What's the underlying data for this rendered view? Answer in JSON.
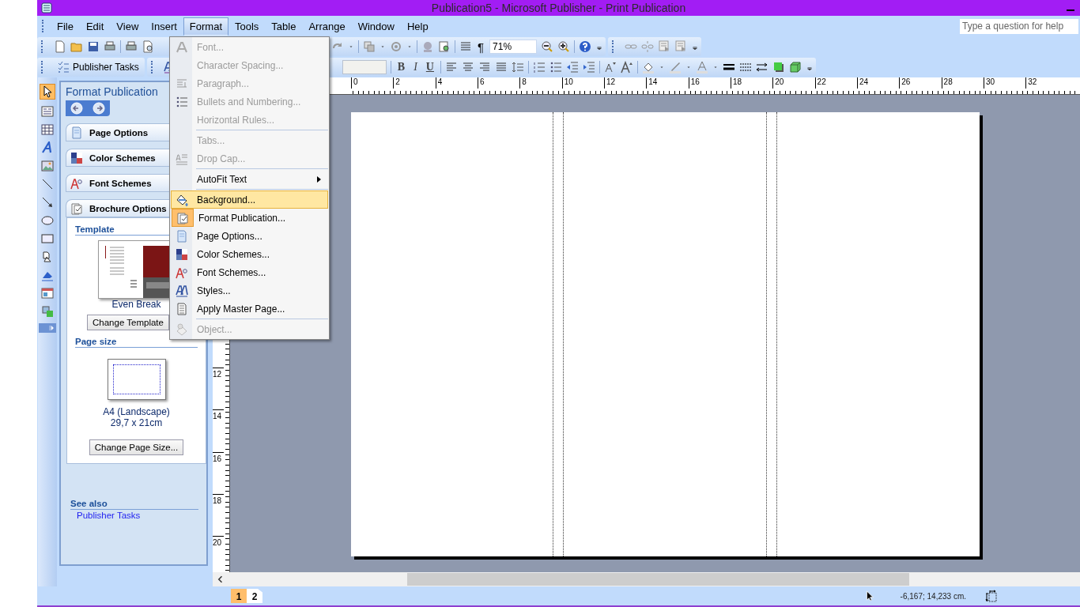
{
  "window": {
    "title": "Publication5 - Microsoft Publisher - Print Publication"
  },
  "menu_bar": {
    "items": [
      {
        "label": "File",
        "selected": false
      },
      {
        "label": "Edit",
        "selected": false
      },
      {
        "label": "View",
        "selected": false
      },
      {
        "label": "Insert",
        "selected": false
      },
      {
        "label": "Format",
        "selected": true
      },
      {
        "label": "Tools",
        "selected": false
      },
      {
        "label": "Table",
        "selected": false
      },
      {
        "label": "Arrange",
        "selected": false
      },
      {
        "label": "Window",
        "selected": false
      },
      {
        "label": "Help",
        "selected": false
      }
    ],
    "help_box": {
      "placeholder": "Type a question for help"
    }
  },
  "toolbar": {
    "tasks_button": "Publisher Tasks",
    "pilcrow": "¶",
    "zoom": "71%",
    "bold": "B",
    "italic": "I",
    "underline": "U"
  },
  "format_menu": {
    "items": [
      {
        "kind": "item",
        "label": "Font...",
        "disabled": true,
        "selected": false,
        "checked": false
      },
      {
        "kind": "item",
        "label": "Character Spacing...",
        "disabled": true,
        "selected": false,
        "checked": false
      },
      {
        "kind": "item",
        "label": "Paragraph...",
        "disabled": true,
        "selected": false,
        "checked": false
      },
      {
        "kind": "item",
        "label": "Bullets and Numbering...",
        "disabled": true,
        "selected": false,
        "checked": false
      },
      {
        "kind": "item",
        "label": "Horizontal Rules...",
        "disabled": true,
        "selected": false,
        "checked": false
      },
      {
        "kind": "separator"
      },
      {
        "kind": "item",
        "label": "Tabs...",
        "disabled": true,
        "selected": false,
        "checked": false
      },
      {
        "kind": "item",
        "label": "Drop Cap...",
        "disabled": true,
        "selected": false,
        "checked": false
      },
      {
        "kind": "separator"
      },
      {
        "kind": "submenu",
        "label": "AutoFit Text",
        "disabled": false,
        "selected": false,
        "checked": false
      },
      {
        "kind": "separator"
      },
      {
        "kind": "item",
        "label": "Background...",
        "disabled": false,
        "selected": true,
        "checked": false
      },
      {
        "kind": "item",
        "label": "Format Publication...",
        "disabled": false,
        "selected": false,
        "checked": true
      },
      {
        "kind": "item",
        "label": "Page Options...",
        "disabled": false,
        "selected": false,
        "checked": false
      },
      {
        "kind": "item",
        "label": "Color Schemes...",
        "disabled": false,
        "selected": false,
        "checked": false
      },
      {
        "kind": "item",
        "label": "Font Schemes...",
        "disabled": false,
        "selected": false,
        "checked": false
      },
      {
        "kind": "item",
        "label": "Styles...",
        "disabled": false,
        "selected": false,
        "checked": false
      },
      {
        "kind": "item",
        "label": "Apply Master Page...",
        "disabled": false,
        "selected": false,
        "checked": false
      },
      {
        "kind": "separator"
      },
      {
        "kind": "item",
        "label": "Object...",
        "disabled": true,
        "selected": false,
        "checked": false
      }
    ]
  },
  "task_pane": {
    "title": "Format Publication",
    "sections": [
      {
        "label": "Page Options"
      },
      {
        "label": "Color Schemes"
      },
      {
        "label": "Font Schemes"
      },
      {
        "label": "Brochure Options"
      }
    ],
    "template": {
      "heading": "Template",
      "name": "Even Break",
      "button": "Change Template"
    },
    "page_size": {
      "heading": "Page size",
      "name": "A4 (Landscape)",
      "dimensions": "29,7 x 21cm",
      "button": "Change Page Size..."
    },
    "see_also": {
      "heading": "See also",
      "links": [
        "Publisher Tasks"
      ]
    }
  },
  "rulers": {
    "horizontal": [
      "0",
      "2",
      "4",
      "6",
      "8",
      "10",
      "12",
      "14",
      "16",
      "18",
      "20",
      "22",
      "24",
      "26",
      "28",
      "30",
      "32"
    ],
    "vertical": [
      "12",
      "14",
      "16",
      "18",
      "20"
    ]
  },
  "status_bar": {
    "pages": [
      {
        "label": "1",
        "selected": true
      },
      {
        "label": "2",
        "selected": false
      }
    ],
    "position": "-6,167; 14,233 cm."
  }
}
